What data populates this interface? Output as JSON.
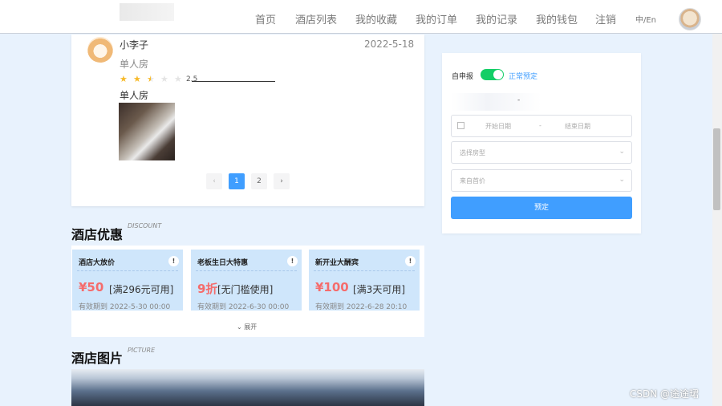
{
  "nav": {
    "items": [
      "首页",
      "酒店列表",
      "我的收藏",
      "我的订单",
      "我的记录",
      "我的钱包",
      "注销"
    ],
    "lang": "中/En"
  },
  "review": {
    "user": "小李子",
    "date": "2022-5-18",
    "room_type": "单人房",
    "rating": "2.5",
    "rating_value": 2.5,
    "rating_max": 5,
    "text": "单人房"
  },
  "pager": {
    "prev": "‹",
    "pages": [
      "1",
      "2"
    ],
    "active": "1",
    "next": "›"
  },
  "discount": {
    "title": "酒店优惠",
    "sub": "DISCOUNT",
    "coupons": [
      {
        "name": "酒店大放价",
        "amount": "¥50",
        "cond": "[满296元可用]",
        "expiry": "有效期到 2022-5-30 00:00"
      },
      {
        "name": "老板生日大特惠",
        "amount": "9折",
        "cond": "[无门槛使用]",
        "expiry": "有效期到 2022-6-30 00:00"
      },
      {
        "name": "新开业大酬宾",
        "amount": "¥100",
        "cond": "[满3天可用]",
        "expiry": "有效期到 2022-6-28 20:10"
      }
    ],
    "info": "!",
    "expand": "⌄ 展开"
  },
  "picture": {
    "title": "酒店图片",
    "sub": "PICTURE"
  },
  "booking": {
    "self_report": "自申报",
    "switch_on": true,
    "normal": "正常预定",
    "dash": "-",
    "start_placeholder": "开始日期",
    "range_sep": "-",
    "end_placeholder": "结束日期",
    "room_placeholder": "选择房型",
    "price_placeholder": "来自首价",
    "submit": "预定"
  },
  "watermark": "CSDN @途途珺",
  "colors": {
    "primary": "#409eff",
    "switch": "#13ce66",
    "price": "#f56c6c",
    "coupon_bg": "#cfe6fb",
    "page_bg": "#e8f2fd"
  }
}
